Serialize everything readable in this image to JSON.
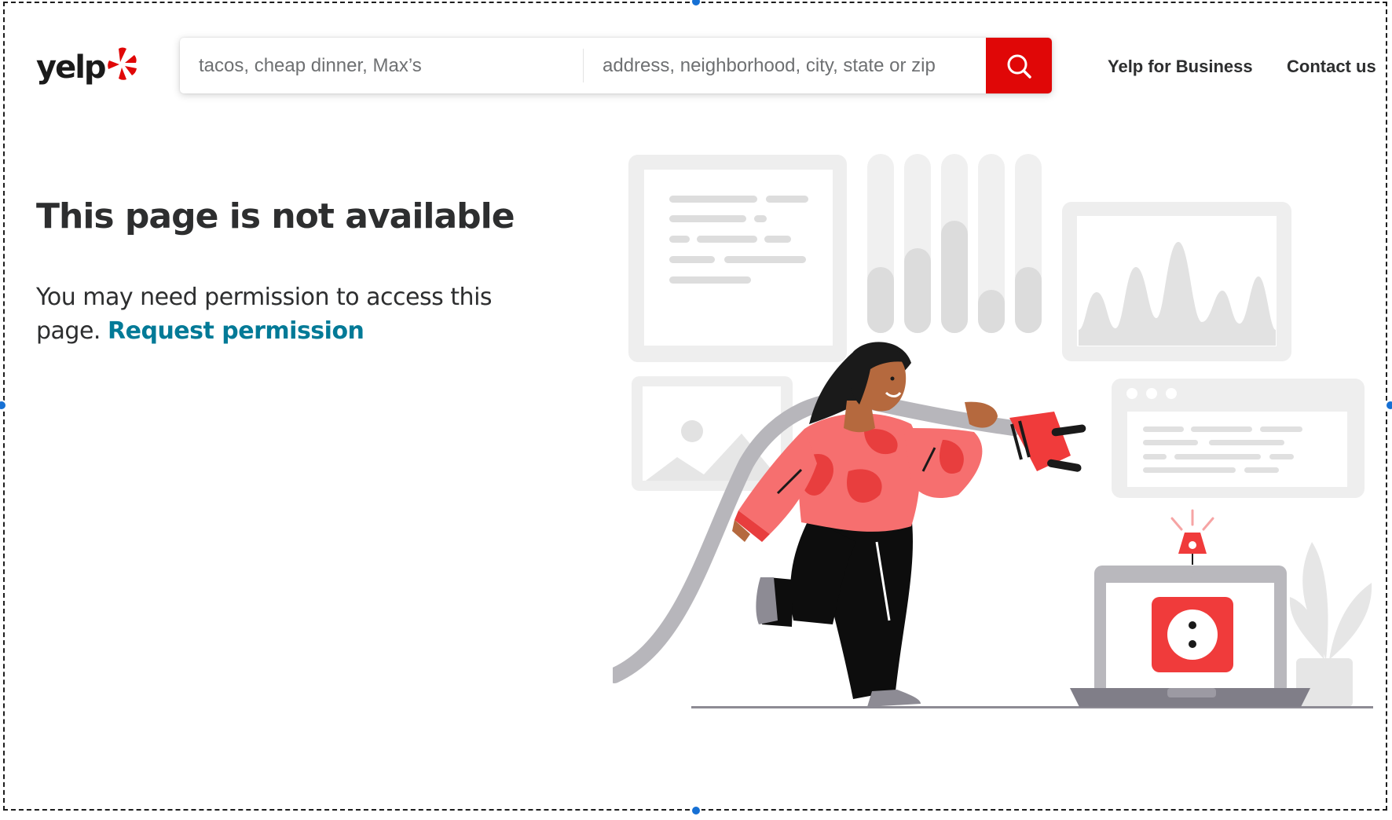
{
  "header": {
    "logo_text": "yelp",
    "search": {
      "find_placeholder": "tacos, cheap dinner, Max’s",
      "near_placeholder": "address, neighborhood, city, state or zip",
      "button_icon": "search-icon"
    },
    "nav": {
      "business_label": "Yelp for Business",
      "contact_label": "Contact us"
    }
  },
  "main": {
    "title": "This page is not available",
    "message": "You may need permission to access this page.",
    "link_label": "Request permission"
  },
  "colors": {
    "brand_red": "#e00707",
    "link_teal": "#027a97",
    "text_dark": "#2d2e2f"
  }
}
